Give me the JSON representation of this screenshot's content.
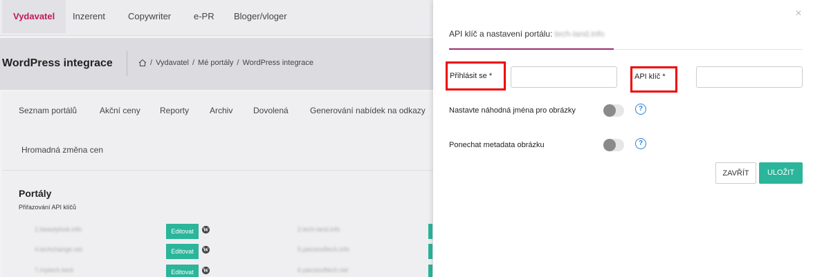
{
  "top_tabs": [
    "Vydavatel",
    "Inzerent",
    "Copywriter",
    "e-PR",
    "Bloger/vloger"
  ],
  "page_title": "WordPress integrace",
  "breadcrumb": [
    "Vydavatel",
    "Mé portály",
    "WordPress integrace"
  ],
  "breadcrumb_sep": "/",
  "subnav": [
    "Seznam portálů",
    "Akční ceny",
    "Reporty",
    "Archiv",
    "Dovolená",
    "Generování nabídek na odkazy",
    "Hromadná změna cen"
  ],
  "portaly": {
    "title": "Portály",
    "subtitle": "Přiřazování API klíčů",
    "edit_label": "Editovat",
    "wp_glyph": "W",
    "left_col": [
      "1.beautylook.info",
      "4.techchange.net",
      "7.mytech.best"
    ],
    "right_col": [
      "2.tech-land.info",
      "5.piecesoftech.info",
      "6.piecesoftech.net"
    ]
  },
  "modal": {
    "close_glyph": "×",
    "title": "API klíč a nastavení portálu:",
    "host": "tech-land.info",
    "login_label": "Přihlásit se *",
    "login_value": "",
    "api_label": "API klíč *",
    "api_value": "",
    "random_names_label": "Nastavte náhodná jména pro obrázky",
    "keep_metadata_label": "Ponechat metadata obrázku",
    "help_glyph": "?",
    "close_button": "ZAVŘÍT",
    "save_button": "ULOŽIT",
    "random_names_on": false,
    "keep_metadata_on": false
  },
  "colors": {
    "accent": "#c2185b",
    "underline": "#9b2a6e",
    "primary": "#2bb59a",
    "highlight": "#ee0000",
    "help": "#2b7fd6"
  }
}
